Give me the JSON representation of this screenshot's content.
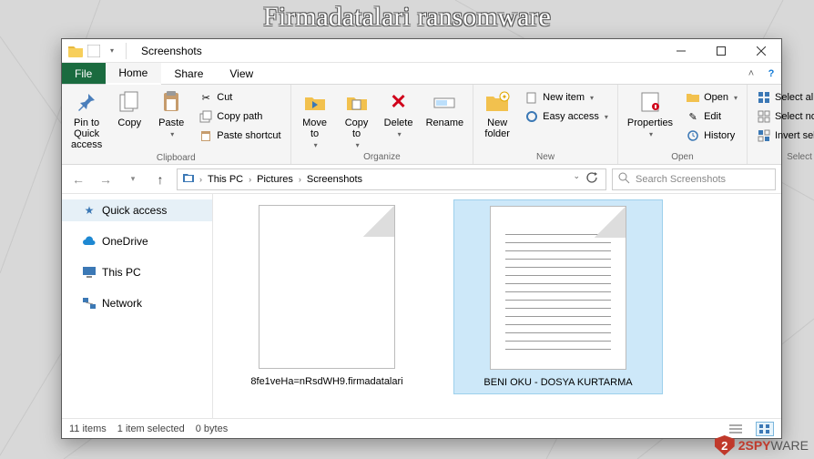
{
  "banner": {
    "title": "Firmadatalari ransomware"
  },
  "window": {
    "title": "Screenshots",
    "tabs": {
      "file": "File",
      "home": "Home",
      "share": "Share",
      "view": "View"
    },
    "ribbon": {
      "clipboard": {
        "label": "Clipboard",
        "pin": "Pin to Quick\naccess",
        "copy": "Copy",
        "paste": "Paste",
        "cut": "Cut",
        "copy_path": "Copy path",
        "paste_shortcut": "Paste shortcut"
      },
      "organize": {
        "label": "Organize",
        "move_to": "Move\nto",
        "copy_to": "Copy\nto",
        "delete": "Delete",
        "rename": "Rename"
      },
      "new": {
        "label": "New",
        "new_folder": "New\nfolder",
        "new_item": "New item",
        "easy_access": "Easy access"
      },
      "open": {
        "label": "Open",
        "properties": "Properties",
        "open": "Open",
        "edit": "Edit",
        "history": "History"
      },
      "select": {
        "label": "Select",
        "select_all": "Select all",
        "select_none": "Select none",
        "invert": "Invert selection"
      }
    },
    "breadcrumbs": [
      "This PC",
      "Pictures",
      "Screenshots"
    ],
    "search_placeholder": "Search Screenshots",
    "navpane": {
      "quick_access": "Quick access",
      "onedrive": "OneDrive",
      "this_pc": "This PC",
      "network": "Network"
    },
    "files": [
      {
        "name": "8fe1veHa=nRsdWH9.firmadatalari"
      },
      {
        "name": "BENI OKU - DOSYA KURTARMA"
      }
    ],
    "status": {
      "item_count": "11 items",
      "selection": "1 item selected",
      "size": "0 bytes"
    }
  },
  "watermark": {
    "brand_a": "2SPY",
    "brand_b": "WARE"
  }
}
